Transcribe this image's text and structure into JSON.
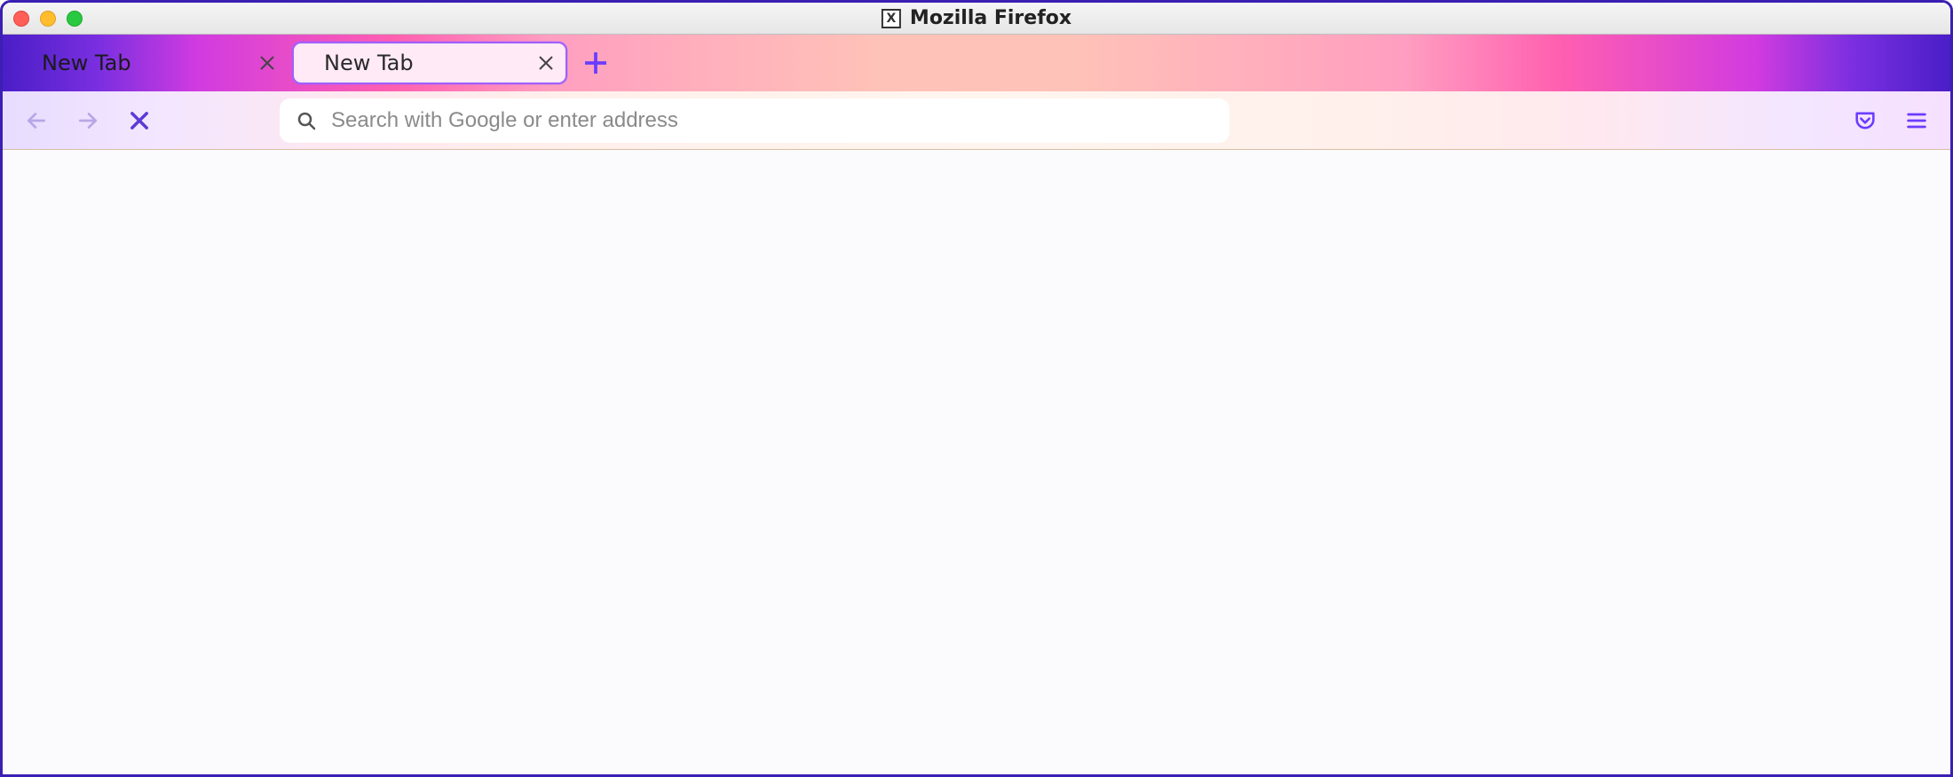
{
  "window": {
    "title": "Mozilla Firefox",
    "app_icon_label": "X"
  },
  "tabs": [
    {
      "label": "New Tab",
      "active": false
    },
    {
      "label": "New Tab",
      "active": true
    }
  ],
  "navbar": {
    "address_value": "",
    "address_placeholder": "Search with Google or enter address"
  },
  "icons": {
    "back": "back-icon",
    "forward": "forward-icon",
    "stop": "stop-icon",
    "search": "search-icon",
    "pocket": "pocket-icon",
    "menu": "hamburger-icon",
    "newtab": "plus-icon",
    "close": "close-icon"
  }
}
